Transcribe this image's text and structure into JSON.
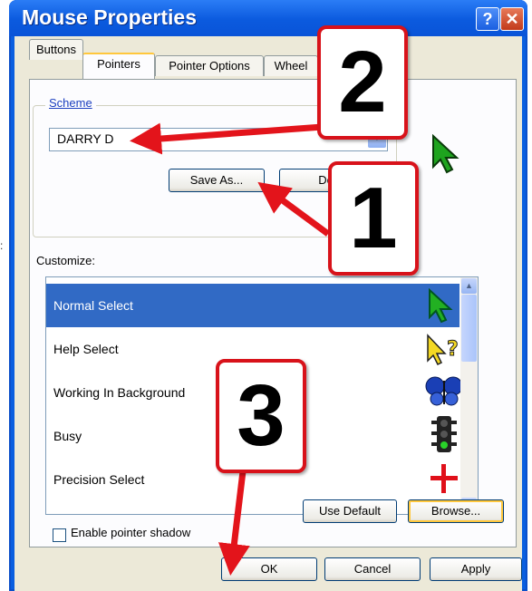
{
  "window": {
    "title": "Mouse Properties",
    "help_glyph": "?",
    "close_glyph": "✕"
  },
  "tabs": [
    {
      "label": "Buttons"
    },
    {
      "label": "Pointers"
    },
    {
      "label": "Pointer Options"
    },
    {
      "label": "Wheel"
    }
  ],
  "scheme": {
    "group_label": "Scheme",
    "selected": "DARRY D",
    "save_as_label": "Save As...",
    "delete_label": "Del"
  },
  "customize": {
    "label": "Customize:",
    "items": [
      {
        "label": "Normal Select",
        "icon": "green-arrow-cursor-icon"
      },
      {
        "label": "Help Select",
        "icon": "help-cursor-icon"
      },
      {
        "label": "Working In Background",
        "icon": "butterfly-cursor-icon"
      },
      {
        "label": "Busy",
        "icon": "traffic-light-cursor-icon"
      },
      {
        "label": "Precision Select",
        "icon": "red-crosshair-cursor-icon"
      }
    ]
  },
  "shadow_checkbox": {
    "label": "Enable pointer shadow",
    "checked": false
  },
  "buttons": {
    "use_default": "Use Default",
    "browse": "Browse...",
    "ok": "OK",
    "cancel": "Cancel",
    "apply": "Apply"
  },
  "callouts": [
    "1",
    "2",
    "3"
  ],
  "colors": {
    "title_bar": "#0a5fe0",
    "selection": "#316ac5",
    "callout_border": "#d8121a",
    "annotation_arrow": "#e3141b"
  }
}
